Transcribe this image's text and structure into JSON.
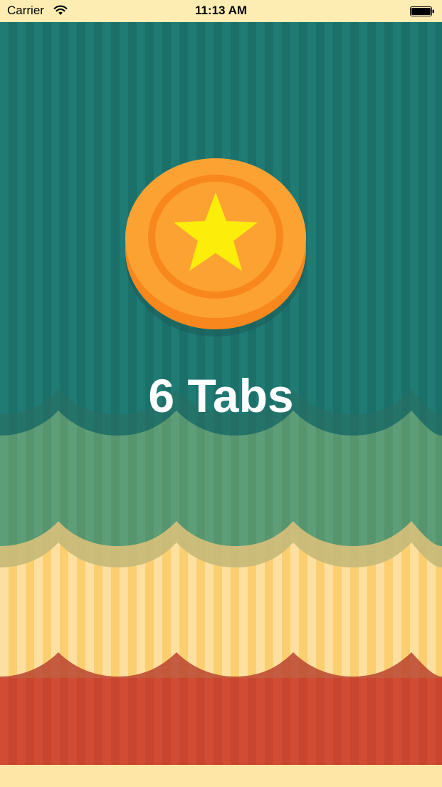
{
  "status_bar": {
    "carrier": "Carrier",
    "time": "11:13 AM",
    "wifi_icon": "wifi-icon",
    "battery_icon": "battery-icon"
  },
  "main": {
    "coin_icon": "star-coin-icon",
    "title": "6 Tabs"
  },
  "colors": {
    "teal": "#1e7b74",
    "teal_stripe": "#207069",
    "green": "#5b9a72",
    "cream": "#fcd87c",
    "cream_light": "#fde6a6",
    "red": "#cf4a33",
    "coin_orange": "#fca233",
    "coin_dark": "#f8871e",
    "star": "#fcee0a"
  }
}
